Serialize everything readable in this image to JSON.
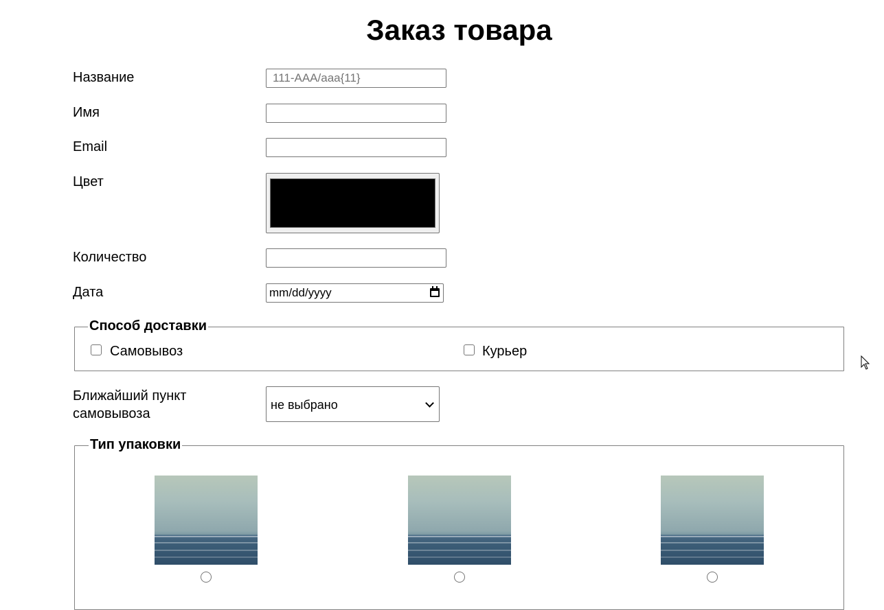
{
  "page": {
    "title": "Заказ товара"
  },
  "fields": {
    "name": {
      "label": "Название",
      "placeholder": "111-AAA/aaa{11}",
      "value": ""
    },
    "person": {
      "label": "Имя",
      "value": ""
    },
    "email": {
      "label": "Email",
      "value": ""
    },
    "color": {
      "label": "Цвет",
      "value": "#000000"
    },
    "quantity": {
      "label": "Количество",
      "value": ""
    },
    "date": {
      "label": "Дата",
      "placeholder": "mm/dd/yyyy"
    }
  },
  "delivery": {
    "legend": "Способ доставки",
    "options": [
      {
        "label": "Самовывоз",
        "checked": false
      },
      {
        "label": "Курьер",
        "checked": false
      }
    ]
  },
  "pickup": {
    "label_line1": "Ближайший пункт",
    "label_line2": "самовывоза",
    "selected": "не выбрано"
  },
  "packaging": {
    "legend": "Тип упаковки",
    "options": [
      {
        "image": "sea-photo",
        "checked": false
      },
      {
        "image": "sea-photo",
        "checked": false
      },
      {
        "image": "sea-photo",
        "checked": false
      }
    ]
  }
}
